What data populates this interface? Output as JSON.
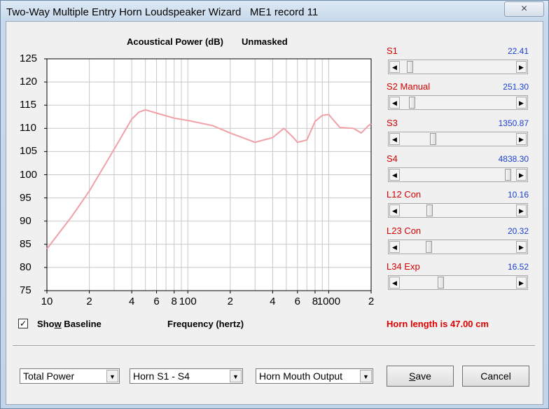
{
  "window": {
    "title": "Two-Way Multiple Entry Horn Loudspeaker Wizard   ME1 record 11",
    "close_icon": "×"
  },
  "chart_data": {
    "type": "line",
    "title": "Acoustical Power (dB)",
    "mode_label": "Unmasked",
    "xlabel": "Frequency (hertz)",
    "ylabel": "",
    "x_scale": "log",
    "xlim": [
      10,
      2000
    ],
    "ylim": [
      75,
      125
    ],
    "y_ticks": [
      "125",
      "120",
      "115",
      "110",
      "105",
      "100",
      "95",
      "90",
      "85",
      "80",
      "75"
    ],
    "x_tick_labels": [
      "10",
      "2",
      "4",
      "6",
      "8",
      "100",
      "2",
      "4",
      "6",
      "8",
      "1000",
      "2"
    ],
    "grid": true,
    "series": [
      {
        "color": "#f2a0a8",
        "x": [
          10,
          15,
          20,
          30,
          40,
          45,
          50,
          60,
          80,
          100,
          150,
          200,
          300,
          400,
          480,
          550,
          600,
          700,
          800,
          900,
          1000,
          1100,
          1200,
          1500,
          1700,
          1900,
          2000
        ],
        "y": [
          84,
          91,
          96.5,
          105.5,
          112,
          113.5,
          114,
          113.3,
          112.2,
          111.7,
          110.6,
          109,
          107,
          108,
          110,
          108.3,
          107,
          107.5,
          111.5,
          112.8,
          113,
          111.5,
          110.2,
          110,
          109,
          110.5,
          111
        ]
      }
    ]
  },
  "baseline": {
    "label_pre": "Sho",
    "label_u": "w",
    "label_post": " Baseline",
    "checked": true,
    "check_mark": "✓"
  },
  "sliders": [
    {
      "name": "S1",
      "value": "22.41",
      "position": 0.06
    },
    {
      "name": "S2  Manual",
      "value": "251.30",
      "position": 0.08
    },
    {
      "name": "S3",
      "value": "1350.87",
      "position": 0.27
    },
    {
      "name": "S4",
      "value": "4838.30",
      "position": 0.96
    },
    {
      "name": "L12  Con",
      "value": "10.16",
      "position": 0.24
    },
    {
      "name": "L23  Con",
      "value": "20.32",
      "position": 0.23
    },
    {
      "name": "L34  Exp",
      "value": "16.52",
      "position": 0.34
    }
  ],
  "horn_length": "Horn length is 47.00 cm",
  "combos": [
    {
      "value": "Total Power"
    },
    {
      "value": "Horn S1 - S4"
    },
    {
      "value": "Horn Mouth Output"
    }
  ],
  "buttons": {
    "save_pre": "",
    "save_u": "S",
    "save_post": "ave",
    "cancel": "Cancel"
  },
  "icons": {
    "left_arrow": "◀",
    "right_arrow": "▶",
    "dropdown": "▼"
  }
}
